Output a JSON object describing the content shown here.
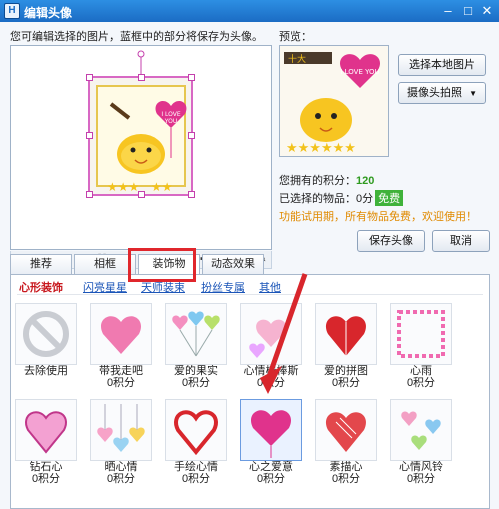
{
  "window": {
    "title": "编辑头像",
    "icon_text": "H"
  },
  "editor": {
    "hint": "您可编辑选择的图片，蓝框中的部分将保存为头像。",
    "tools": [
      "rotate-icon",
      "zoom-in-icon",
      "zoom-out-icon",
      "rotate-cw-icon",
      "fit-icon",
      "crop-icon",
      "undo-icon",
      "delete-icon",
      "mosaic-icon",
      "text-icon",
      "brush-icon"
    ]
  },
  "preview": {
    "label": "预览：",
    "sticker_text": "I LOVE YOU",
    "banner_text": "十大",
    "select_local_label": "选择本地图片",
    "camera_label": "摄像头拍照"
  },
  "info": {
    "points_label": "您拥有的积分：",
    "points_value": "120",
    "selected_label": "已选择的物品：",
    "selected_value": "0分",
    "free_tag": "免费",
    "notice": "功能试用期，所有物品免费，欢迎使用！"
  },
  "actions": {
    "save_label": "保存头像",
    "cancel_label": "取消"
  },
  "tabs": [
    "推荐",
    "相框",
    "装饰物",
    "动态效果"
  ],
  "subcategories": [
    "心形装饰",
    "闪亮星星",
    "天师装束",
    "扮丝专属",
    "其他"
  ],
  "items": [
    {
      "name": "去除使用",
      "price": ""
    },
    {
      "name": "带我走吧",
      "price": "0积分"
    },
    {
      "name": "爱的果实",
      "price": "0积分"
    },
    {
      "name": "心情棒棒斯",
      "price": "0积分"
    },
    {
      "name": "爱的拼图",
      "price": "0积分"
    },
    {
      "name": "心雨",
      "price": "0积分"
    },
    {
      "name": "钻石心",
      "price": "0积分"
    },
    {
      "name": "晒心情",
      "price": "0积分"
    },
    {
      "name": "手绘心情",
      "price": "0积分"
    },
    {
      "name": "心之爱意",
      "price": "0积分"
    },
    {
      "name": "素描心",
      "price": "0积分"
    },
    {
      "name": "心情风铃",
      "price": "0积分"
    }
  ],
  "colors": {
    "title_bar": "#1b6cc4",
    "accent_pink": "#e0338c",
    "highlight_red": "#e0262c",
    "points_green": "#2e9a1f",
    "notice_orange": "#e08a00"
  }
}
